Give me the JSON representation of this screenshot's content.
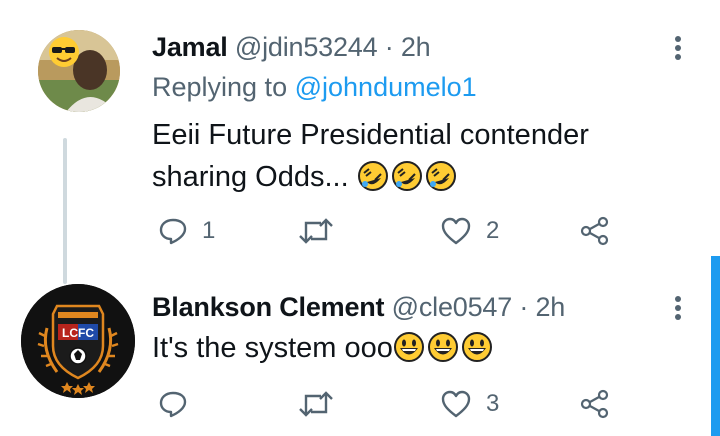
{
  "tweets": [
    {
      "display_name": "Jamal",
      "handle": "@jdin53244",
      "separator": "·",
      "time": "2h",
      "replying_prefix": "Replying to",
      "replying_to": "@johndumelo1",
      "text_line1": "Eeii Future Presidential contender",
      "text_line2": "sharing Odds...",
      "emoji": [
        "rolling-on-floor-laughing",
        "rolling-on-floor-laughing",
        "rolling-on-floor-laughing"
      ],
      "reply_count": "1",
      "retweet_count": "",
      "like_count": "2"
    },
    {
      "display_name": "Blankson Clement",
      "handle": "@cle0547",
      "separator": "·",
      "time": "2h",
      "text": "It's the system ooo",
      "emoji": [
        "grinning-face",
        "grinning-face",
        "grinning-face"
      ],
      "reply_count": "",
      "retweet_count": "",
      "like_count": "3"
    }
  ],
  "avatar_badge_text": "LCFC",
  "colors": {
    "text": "#0f1419",
    "secondary": "#536471",
    "link": "#1d9bf0",
    "thread_line": "#cfd9de",
    "emoji_yellow": "#ffcc33"
  }
}
